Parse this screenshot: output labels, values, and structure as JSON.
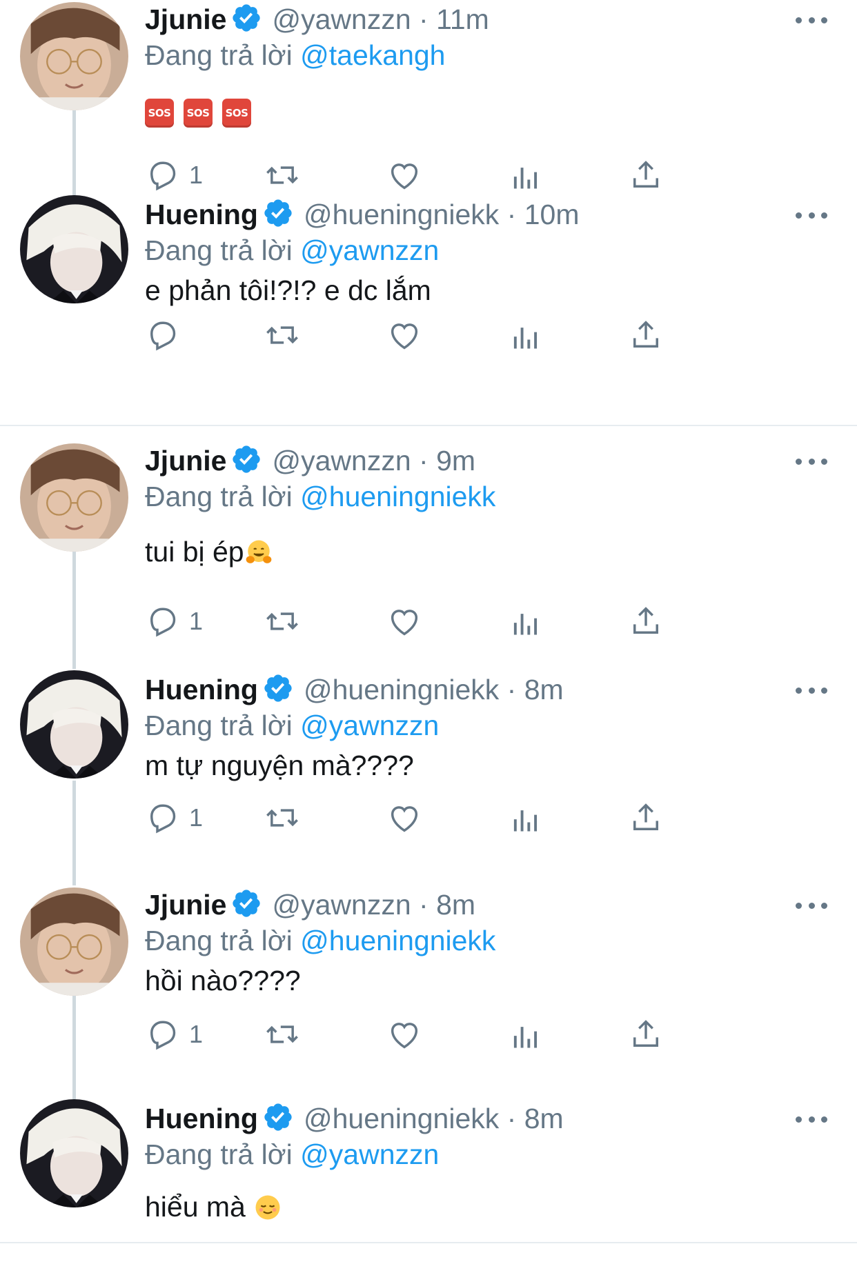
{
  "reply_prefix": "Đang trả lời",
  "dot": "·",
  "tweets": [
    {
      "name": "Jjunie",
      "handle": "@yawnzzn",
      "time": "11m",
      "reply_to": "@taekangh",
      "text": "",
      "emoji": [
        "sos",
        "sos",
        "sos"
      ],
      "reply_count": "1"
    },
    {
      "name": "Huening",
      "handle": "@hueningniekk",
      "time": "10m",
      "reply_to": "@yawnzzn",
      "text": "e phản tôi!?!? e dc lắm",
      "reply_count": ""
    },
    {
      "name": "Jjunie",
      "handle": "@yawnzzn",
      "time": "9m",
      "reply_to": "@hueningniekk",
      "text": "tui bị ép",
      "emoji_trailing": "hugging-face",
      "reply_count": "1"
    },
    {
      "name": "Huening",
      "handle": "@hueningniekk",
      "time": "8m",
      "reply_to": "@yawnzzn",
      "text": "m tự nguyện mà????",
      "reply_count": "1"
    },
    {
      "name": "Jjunie",
      "handle": "@yawnzzn",
      "time": "8m",
      "reply_to": "@hueningniekk",
      "text": "hồi nào????",
      "reply_count": "1"
    },
    {
      "name": "Huening",
      "handle": "@hueningniekk",
      "time": "8m",
      "reply_to": "@yawnzzn",
      "text": "hiểu mà ",
      "emoji_trailing": "relieved-face"
    }
  ],
  "sos_label": "SOS",
  "colors": {
    "link": "#1d9bf0",
    "muted": "#657786",
    "verified": "#1d9bf0",
    "thread_line": "#cfd9de"
  }
}
